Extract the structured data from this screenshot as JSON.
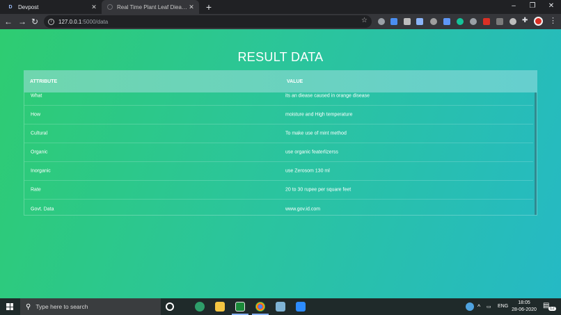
{
  "browser": {
    "tabs": [
      {
        "favicon": "D",
        "label": "Devpost",
        "active": false
      },
      {
        "favicon": "loading-icon",
        "label": "Real Time Plant Leaf Diease Dete",
        "active": true
      }
    ],
    "new_tab_icon": "+",
    "window_controls": {
      "minimize": "–",
      "maximize": "❐",
      "close": "✕"
    },
    "nav": {
      "back": "←",
      "forward": "→",
      "reload": "↻"
    },
    "address": {
      "host": "127.0.0.1",
      "path": ":5000/data"
    },
    "menu_icon": "⋮"
  },
  "page": {
    "title": "RESULT DATA",
    "table": {
      "headers": {
        "attribute": "ATTRIBUTE",
        "value": "VALUE"
      },
      "rows": [
        {
          "attribute": "What",
          "value": "its an diease caused in orange disease"
        },
        {
          "attribute": "How",
          "value": "moisture and High temperature"
        },
        {
          "attribute": "Cultural",
          "value": "To make use of mint method"
        },
        {
          "attribute": "Organic",
          "value": "use organic featerlizerss"
        },
        {
          "attribute": "Inorganic",
          "value": "use Zerosom 130 ml"
        },
        {
          "attribute": "Rate",
          "value": "20 to 30 rupee per square feet"
        },
        {
          "attribute": "Govt. Data",
          "value": "www.gov.id.com"
        }
      ]
    },
    "colors": {
      "gradient_start": "#2ecc71",
      "gradient_end": "#25b9c5",
      "header": "#6fd6ae"
    }
  },
  "taskbar": {
    "search_placeholder": "Type here to search",
    "language": "ENG",
    "time": "18:05",
    "date": "28-06-2020",
    "notification_count": "12"
  }
}
